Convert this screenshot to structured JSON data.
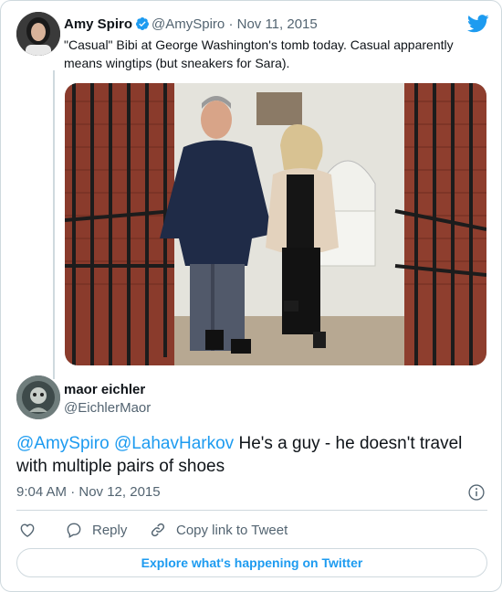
{
  "parent_tweet": {
    "author_name": "Amy Spiro",
    "handle": "@AmySpiro",
    "separator": "·",
    "date": "Nov 11, 2015",
    "text": "\"Casual\" Bibi at George Washington's tomb today. Casual apparently means wingtips (but sneakers for Sara).",
    "avatar_icon": "avatar-photo",
    "verified_icon": "verified-badge-icon",
    "brand_icon": "twitter-bird-icon",
    "photo_icon": "tweet-photo"
  },
  "reply_tweet": {
    "author_name": "maor eichler",
    "handle": "@EichlerMaor",
    "mentions": [
      "@AmySpiro",
      "@LahavHarkov"
    ],
    "text": " He's a guy - he doesn't travel with multiple pairs of shoes",
    "timestamp": "9:04 AM · Nov 12, 2015",
    "info_icon": "info-icon"
  },
  "actions": {
    "like_icon": "heart-icon",
    "reply_label": "Reply",
    "reply_icon": "reply-bubble-icon",
    "copy_label": "Copy link to Tweet",
    "copy_icon": "link-icon"
  },
  "footer": {
    "explore_label": "Explore what's happening on Twitter"
  },
  "colors": {
    "accent": "#1d9bf0",
    "text": "#0f1419",
    "secondary_text": "#536471",
    "border": "#cfd9de"
  }
}
